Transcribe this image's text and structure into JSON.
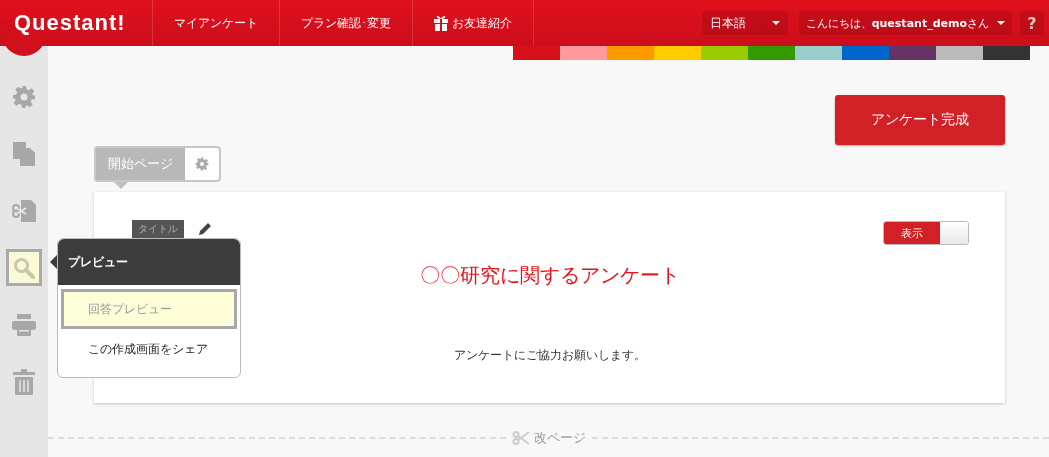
{
  "header": {
    "logo": "Questant!",
    "nav": [
      {
        "kind": "text",
        "label": "マイアンケート"
      },
      {
        "kind": "text",
        "label": "プラン確認･変更"
      },
      {
        "kind": "gift",
        "label": "お友達紹介"
      }
    ],
    "language": "日本語",
    "greeting": "こんにちは、**questant_demo**さん",
    "help": "?"
  },
  "sidebar": [
    {
      "kind": "settings",
      "selected": false
    },
    {
      "kind": "copy",
      "selected": false
    },
    {
      "kind": "cut",
      "selected": false
    },
    {
      "kind": "search",
      "selected": true
    },
    {
      "kind": "print",
      "selected": false
    },
    {
      "kind": "trash",
      "selected": false
    }
  ],
  "palette": [
    {
      "color": "#d7101a"
    },
    {
      "color": "#ff9a9e"
    },
    {
      "color": "#ff9900"
    },
    {
      "color": "#ffcc00"
    },
    {
      "color": "#99cc00"
    },
    {
      "color": "#339900"
    },
    {
      "color": "#99cccc"
    },
    {
      "color": "#0066cc"
    },
    {
      "color": "#663366"
    },
    {
      "color": "#bbbbbb"
    },
    {
      "color": "#333333"
    }
  ],
  "complete_button": "アンケート完成",
  "page_tab": {
    "label": "開始ページ"
  },
  "card": {
    "title_tag": "タイトル",
    "toggle": {
      "label": "表示",
      "on": true
    },
    "title": "〇〇研究に関するアンケート",
    "description": "アンケートにご協力お願いします。"
  },
  "page_break": "改ページ",
  "preview_menu": {
    "title": "プレビュー",
    "items": [
      {
        "label": "回答プレビュー",
        "selected": true
      },
      {
        "label": "この作成画面をシェア",
        "selected": false
      }
    ]
  }
}
